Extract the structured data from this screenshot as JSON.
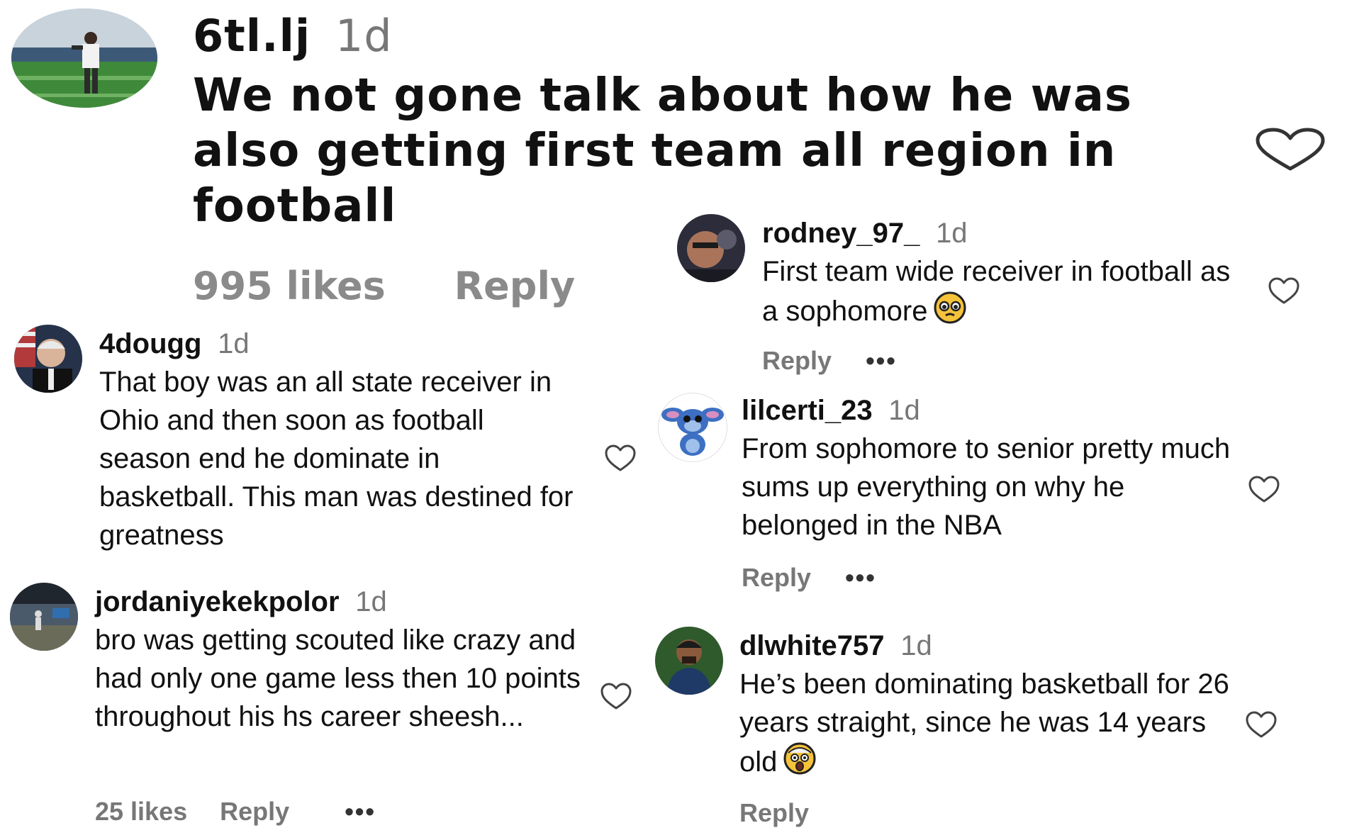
{
  "comments": [
    {
      "username": "6tl.lj",
      "time": "1d",
      "text": "We not gone talk about how he was also getting first team all region in football",
      "likes": "995 likes",
      "reply": "Reply"
    },
    {
      "username": "rodney_97_",
      "time": "1d",
      "text": "First team wide receiver in football as a sophomore",
      "emoji": "pleading-face-emoji",
      "reply": "Reply",
      "more": "•••"
    },
    {
      "username": "4dougg",
      "time": "1d",
      "text": "That boy was an all state receiver in Ohio and then soon as football season end he dominate in basketball. This man was destined for greatness"
    },
    {
      "username": "lilcerti_23",
      "time": "1d",
      "text": "From sophomore to senior pretty much sums up everything on why he belonged in the NBA",
      "reply": "Reply",
      "more": "•••"
    },
    {
      "username": "jordaniyekekpolor",
      "time": "1d",
      "text": "bro was getting scouted like crazy and had only one game less then 10 points throughout his hs career sheesh...",
      "likes": "25 likes",
      "reply": "Reply",
      "more": "•••"
    },
    {
      "username": "dlwhite757",
      "time": "1d",
      "text": "He’s been dominating basketball for 26 years straight, since he was 14 years old",
      "emoji": "astonished-face-emoji",
      "reply": "Reply"
    }
  ],
  "colors": {
    "text": "#111111",
    "muted": "#777777",
    "heart_stroke": "#333333",
    "emoji_yellow": "#f5c23a"
  },
  "icons": [
    "heart-icon",
    "more-options-icon"
  ]
}
